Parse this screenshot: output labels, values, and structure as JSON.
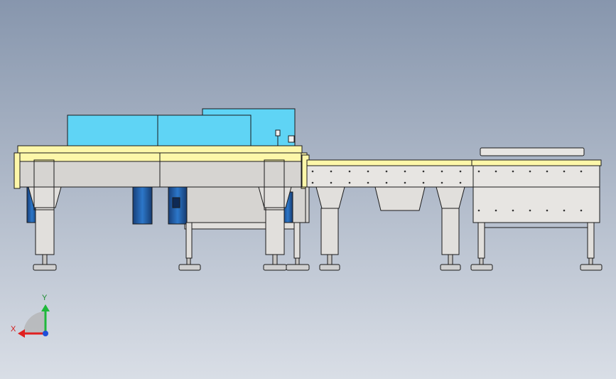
{
  "viewport": {
    "background_top": "#8796ad",
    "background_bottom": "#d9dee6"
  },
  "colors": {
    "frame_rail": "#fdf7a9",
    "frame_body": "#d6d4d1",
    "panel": "#e7e5e2",
    "leg": "#e1dfdc",
    "guard_cyan": "#5fd4f5",
    "motor_blue": "#1f5ea8",
    "foot": "#cfcfcf",
    "outline": "#1a1a1a"
  },
  "machine": {
    "left_conveyor": "left-conveyor-assembly",
    "middle_conveyor": "middle-conveyor-assembly",
    "right_conveyor": "right-conveyor-assembly"
  },
  "triad": {
    "y_label": "Y",
    "x_label": "X",
    "y_color": "#1fb83b",
    "x_color": "#e02020",
    "z_color": "#1f4ed8",
    "label_y_color": "#1a8c2e",
    "label_x_color": "#d01818"
  }
}
